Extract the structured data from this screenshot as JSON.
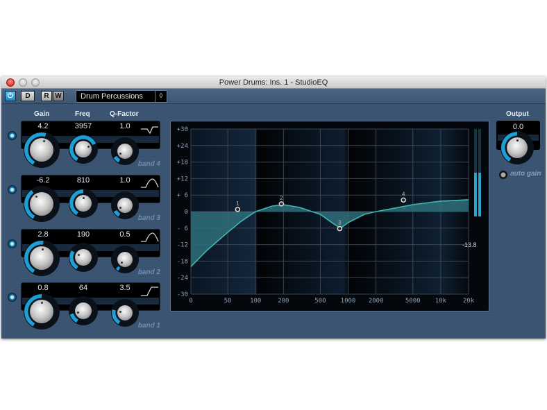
{
  "window": {
    "title": "Power Drums: Ins. 1 - StudioEQ"
  },
  "toolbar": {
    "power": "power-icon",
    "bypass": "D",
    "read": "R",
    "write": "W",
    "preset": "Drum Percussions"
  },
  "headers": {
    "gain": "Gain",
    "freq": "Freq",
    "q": "Q-Factor",
    "output": "Output"
  },
  "bands": [
    {
      "label": "band 4",
      "gain": "4.2",
      "freq": "3957",
      "q": "1.0",
      "shape": "notch-shelf",
      "gain_level": 0.55,
      "freq_level": 0.72,
      "q_level": 0.1,
      "enabled": true
    },
    {
      "label": "band 3",
      "gain": "-6.2",
      "freq": "810",
      "q": "1.0",
      "shape": "bell",
      "gain_level": 0.38,
      "freq_level": 0.5,
      "q_level": 0.1,
      "enabled": true
    },
    {
      "label": "band 2",
      "gain": "2.8",
      "freq": "190",
      "q": "0.5",
      "shape": "bell",
      "gain_level": 0.52,
      "freq_level": 0.3,
      "q_level": 0.05,
      "enabled": true
    },
    {
      "label": "band 1",
      "gain": "0.8",
      "freq": "64",
      "q": "3.5",
      "shape": "shelf",
      "gain_level": 0.5,
      "freq_level": 0.15,
      "q_level": 0.25,
      "enabled": true
    }
  ],
  "output": {
    "value": "0.0",
    "level": 0.5,
    "auto_gain": "auto gain"
  },
  "meter": {
    "readout": "-13.8",
    "level_fraction": 0.5
  },
  "colors": {
    "accent": "#1e9fd6",
    "curve": "#3fb8b0",
    "fill": "#2f6e7a"
  },
  "chart_data": {
    "type": "area",
    "xscale": "log",
    "xlim": [
      20,
      20000
    ],
    "ylim": [
      -30,
      30
    ],
    "grid": true,
    "xticks": [
      {
        "v": 20,
        "label": "0"
      },
      {
        "v": 50,
        "label": "50"
      },
      {
        "v": 100,
        "label": "100"
      },
      {
        "v": 200,
        "label": "200"
      },
      {
        "v": 500,
        "label": "500"
      },
      {
        "v": 1000,
        "label": "1000"
      },
      {
        "v": 2000,
        "label": "2000"
      },
      {
        "v": 5000,
        "label": "5000"
      },
      {
        "v": 10000,
        "label": "10k"
      },
      {
        "v": 20000,
        "label": "20k"
      }
    ],
    "yticks": [
      {
        "v": 30,
        "label": "+30"
      },
      {
        "v": 24,
        "label": "+24"
      },
      {
        "v": 18,
        "label": "+18"
      },
      {
        "v": 12,
        "label": "+12"
      },
      {
        "v": 6,
        "label": "+ 6"
      },
      {
        "v": 0,
        "label": "0"
      },
      {
        "v": -6,
        "label": "- 6"
      },
      {
        "v": -12,
        "label": "-12"
      },
      {
        "v": -18,
        "label": "-18"
      },
      {
        "v": -24,
        "label": "-24"
      },
      {
        "v": -30,
        "label": "-30"
      }
    ],
    "curve": [
      [
        20,
        -20
      ],
      [
        30,
        -14
      ],
      [
        50,
        -7.5
      ],
      [
        70,
        -3.5
      ],
      [
        100,
        0
      ],
      [
        150,
        2
      ],
      [
        200,
        2.5
      ],
      [
        300,
        1.5
      ],
      [
        500,
        -1
      ],
      [
        700,
        -4.5
      ],
      [
        830,
        -6
      ],
      [
        1000,
        -4
      ],
      [
        1500,
        -1
      ],
      [
        2000,
        0
      ],
      [
        5000,
        2.5
      ],
      [
        10000,
        3.8
      ],
      [
        20000,
        4.3
      ]
    ],
    "handles": [
      {
        "label": "1",
        "freq": 64,
        "gain": 0.8
      },
      {
        "label": "2",
        "freq": 190,
        "gain": 2.8
      },
      {
        "label": "3",
        "freq": 810,
        "gain": -6.2
      },
      {
        "label": "4",
        "freq": 3957,
        "gain": 4.2
      }
    ]
  }
}
